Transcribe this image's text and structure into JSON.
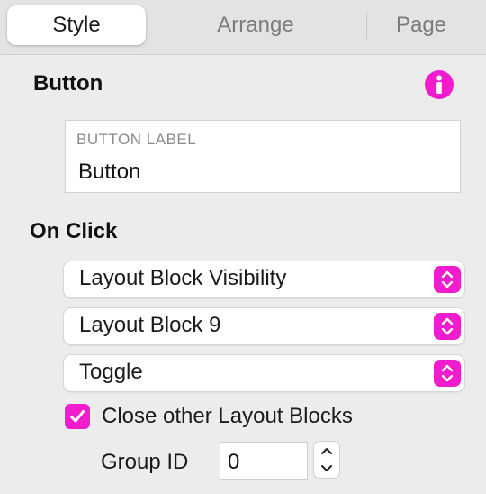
{
  "tabs": [
    {
      "label": "Style",
      "active": true
    },
    {
      "label": "Arrange",
      "active": false
    },
    {
      "label": "Page",
      "active": false
    }
  ],
  "button_section": {
    "title": "Button",
    "info_icon": "info-icon",
    "label_field": {
      "caption": "BUTTON LABEL",
      "value": "Button"
    }
  },
  "on_click": {
    "title": "On Click",
    "action_select": "Layout Block Visibility",
    "target_select": "Layout Block 9",
    "mode_select": "Toggle",
    "close_others": {
      "checked": true,
      "label": "Close other Layout Blocks"
    },
    "group_id": {
      "label": "Group ID",
      "value": "0"
    }
  },
  "colors": {
    "accent": "#f21ccf",
    "panel_bg": "#ececec",
    "tabbar_bg": "#e3e3e3"
  }
}
